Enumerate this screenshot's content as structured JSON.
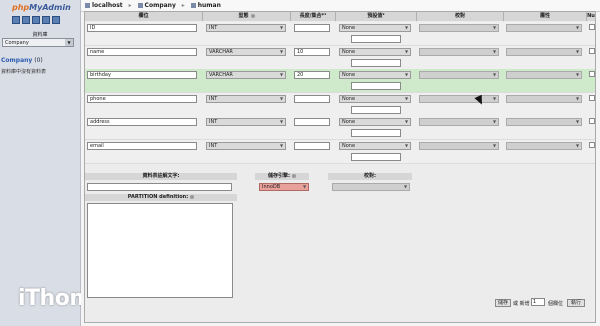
{
  "sidebar": {
    "logo_php": "php",
    "logo_myadmin": "MyAdmin",
    "database_label": "資料庫",
    "database_select": "Company",
    "db_name": "Company",
    "db_count": "(0)",
    "db_empty_text": "資料庫中沒有資料表"
  },
  "watermark": "iThome",
  "breadcrumb": {
    "server": "localhost",
    "database": "Company",
    "table": "human",
    "separator": "▸"
  },
  "columns": {
    "name": "欄位",
    "type": "型態",
    "length": "長度/集合*¹",
    "default": "預設值²",
    "collation": "校對",
    "attributes": "屬性",
    "null": "Nu"
  },
  "fields": [
    {
      "name": "ID",
      "type": "INT",
      "length": "",
      "default": "None"
    },
    {
      "name": "name",
      "type": "VARCHAR",
      "length": "10",
      "default": "None"
    },
    {
      "name": "birthday",
      "type": "VARCHAR",
      "length": "20",
      "default": "None"
    },
    {
      "name": "phone",
      "type": "INT",
      "length": "",
      "default": "None"
    },
    {
      "name": "address",
      "type": "INT",
      "length": "",
      "default": "None"
    },
    {
      "name": "email",
      "type": "INT",
      "length": "",
      "default": "None"
    }
  ],
  "table_comments_label": "資料表註解文字:",
  "storage_engine_label": "儲存引擎:",
  "storage_engine_value": "InnoDB",
  "collation_label": "校對:",
  "partition_label": "PARTITION definition:",
  "footer": {
    "save": "儲存",
    "add_label": "或 新增",
    "add_count": "1",
    "cols_label": "個欄位",
    "go": "執行"
  },
  "colors": {
    "highlight_row": "#cfeacb",
    "engine_select": "#e8a09a",
    "link": "#2b5bb0"
  }
}
